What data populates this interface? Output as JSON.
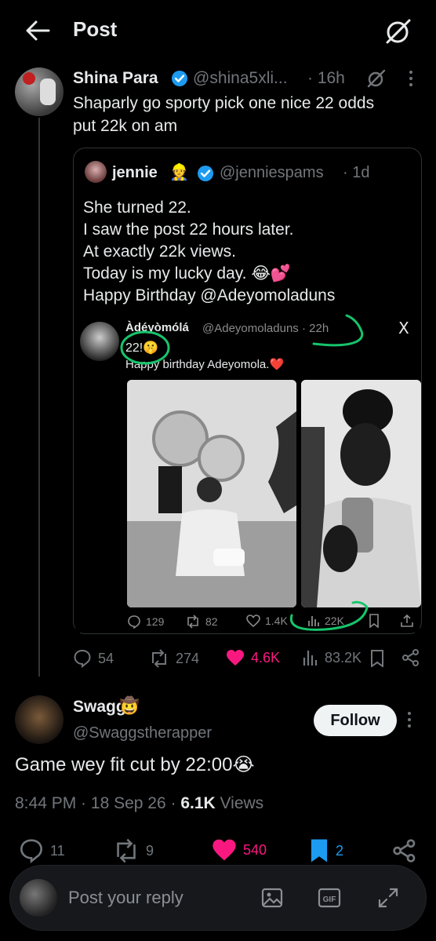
{
  "header": {
    "title": "Post"
  },
  "post1": {
    "name": "Shina Para",
    "handle": "@shina5xli...",
    "time": "· 16h",
    "text_line1": "Shaparly go sporty pick one nice 22 odds",
    "text_line2": "put 22k on am",
    "stats": {
      "replies": "54",
      "reposts": "274",
      "likes": "4.6K",
      "views": "83.2K"
    }
  },
  "quote": {
    "name": "jennie",
    "emoji": "👷",
    "handle": "@jenniespams",
    "time": "· 1d",
    "lines": [
      "She turned 22.",
      "I saw the post 22 hours later.",
      "At exactly 22k views.",
      "Today is my lucky day. 😂💕",
      "Happy Birthday @Adeyomoladuns"
    ]
  },
  "inner": {
    "name": "Àdéyòmólá",
    "handle_time": "@Adeyomoladuns · 22h",
    "x_logo": "X",
    "line1": "22!🤫",
    "line2": "Happy birthday Adeyomola.❤️",
    "stats": {
      "replies": "129",
      "reposts": "82",
      "likes": "1.4K",
      "views": "22K"
    }
  },
  "post2": {
    "name": "Swaggs",
    "emoji": "🤠",
    "handle": "@Swaggstherapper",
    "follow_label": "Follow",
    "text": "Game wey fit cut by 22:00😭",
    "time": "8:44 PM",
    "date": "18 Sep 26",
    "views_count": "6.1K",
    "views_label": "Views",
    "stats": {
      "replies": "11",
      "reposts": "9",
      "likes": "540",
      "bookmarks": "2"
    }
  },
  "reply_bar": {
    "placeholder": "Post your reply"
  },
  "colors": {
    "verified": "#1d9bf0",
    "like": "#f91880",
    "bookmark": "#1d9bf0",
    "annotation": "#17c46b",
    "follow_bg": "#eff3f4"
  },
  "icons": [
    "back-arrow-icon",
    "grok-icon",
    "verified-icon",
    "more-icon",
    "reply-icon",
    "repost-icon",
    "heart-icon",
    "views-icon",
    "bookmark-icon",
    "share-icon",
    "image-icon",
    "gif-icon",
    "expand-icon"
  ]
}
